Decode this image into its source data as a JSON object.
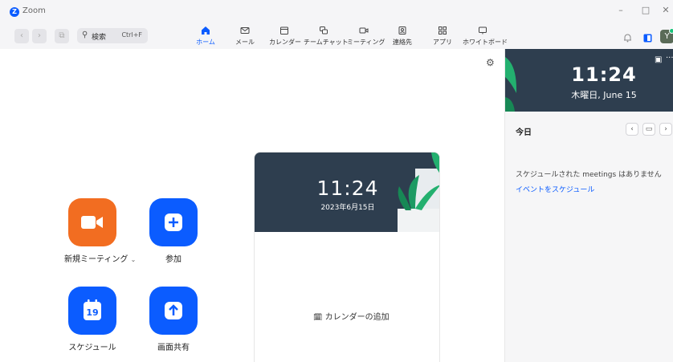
{
  "window": {
    "title": "Zoom",
    "minimize": "–",
    "maximize": "□",
    "close": "✕"
  },
  "search": {
    "placeholder": "検索",
    "shortcut": "Ctrl+F"
  },
  "nav": {
    "tabs": [
      {
        "label": "ホーム",
        "icon": "home-icon",
        "active": true
      },
      {
        "label": "メール",
        "icon": "mail-icon"
      },
      {
        "label": "カレンダー",
        "icon": "calendar-icon"
      },
      {
        "label": "チームチャット",
        "icon": "chat-icon"
      },
      {
        "label": "ミーティング",
        "icon": "video-icon"
      },
      {
        "label": "連絡先",
        "icon": "contacts-icon"
      },
      {
        "label": "アプリ",
        "icon": "apps-icon"
      },
      {
        "label": "ホワイトボード",
        "icon": "whiteboard-icon"
      }
    ]
  },
  "profile": {
    "avatar_initial": "Y"
  },
  "actions": {
    "new_meeting": "新規ミーティング",
    "join": "参加",
    "schedule": "スケジュール",
    "schedule_day": "19",
    "share_screen": "画面共有"
  },
  "card": {
    "time": "11:24",
    "date": "2023年6月15日",
    "add_calendar": "カレンダーの追加"
  },
  "panel": {
    "time": "11:24",
    "date": "木曜日, June 15",
    "today": "今日",
    "empty": "スケジュールされた meetings はありません",
    "schedule_link": "イベントをスケジュール"
  },
  "colors": {
    "brand": "#0b5cff",
    "orange": "#f26d21",
    "hero": "#2e3e4f"
  }
}
